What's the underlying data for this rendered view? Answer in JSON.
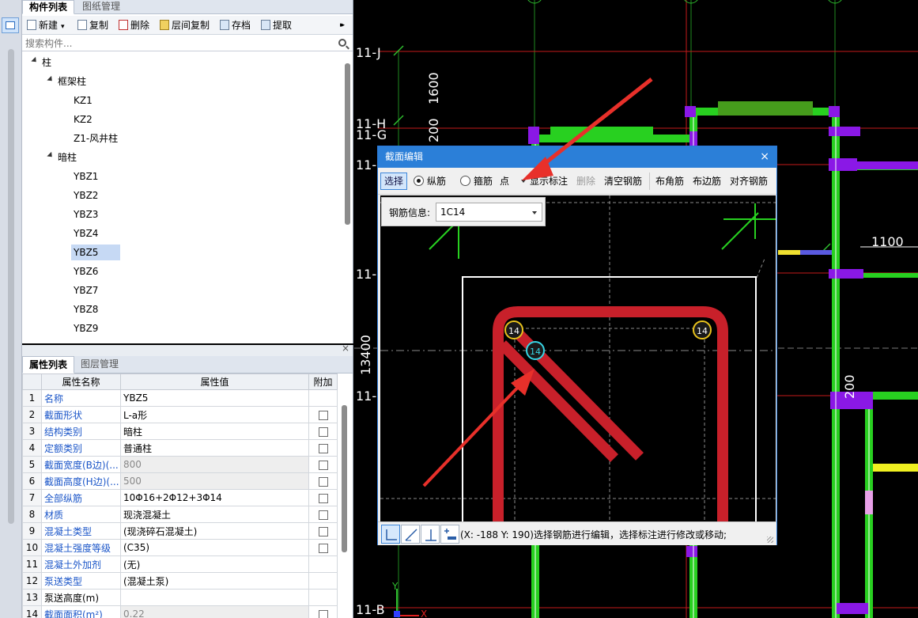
{
  "comp_panel": {
    "tabs": [
      "构件列表",
      "图纸管理"
    ],
    "toolbar": {
      "new": "新建",
      "copy": "复制",
      "delete": "删除",
      "floor_copy": "层间复制",
      "save": "存档",
      "extract": "提取",
      "more": "▸▸"
    },
    "search_placeholder": "搜索构件...",
    "tree": {
      "root": "柱",
      "group1": "框架柱",
      "group1_items": [
        "KZ1",
        "KZ2",
        "Z1-风井柱"
      ],
      "group2": "暗柱",
      "group2_items": [
        "YBZ1",
        "YBZ2",
        "YBZ3",
        "YBZ4",
        "YBZ5",
        "YBZ6",
        "YBZ7",
        "YBZ8",
        "YBZ9"
      ],
      "selected": "YBZ5"
    }
  },
  "prop_panel": {
    "close": "×",
    "tabs": [
      "属性列表",
      "图层管理"
    ],
    "headers": [
      "属性名称",
      "属性值",
      "附加"
    ],
    "rows": [
      {
        "idx": "1",
        "name": "名称",
        "value": "YBZ5"
      },
      {
        "idx": "2",
        "name": "截面形状",
        "value": "L-a形"
      },
      {
        "idx": "3",
        "name": "结构类别",
        "value": "暗柱"
      },
      {
        "idx": "4",
        "name": "定额类别",
        "value": "普通柱"
      },
      {
        "idx": "5",
        "name": "截面宽度(B边)(...",
        "value": "800"
      },
      {
        "idx": "6",
        "name": "截面高度(H边)(...",
        "value": "500"
      },
      {
        "idx": "7",
        "name": "全部纵筋",
        "value": "10Φ16+2Φ12+3Φ14"
      },
      {
        "idx": "8",
        "name": "材质",
        "value": "现浇混凝土"
      },
      {
        "idx": "9",
        "name": "混凝土类型",
        "value": "(现浇碎石混凝土)"
      },
      {
        "idx": "10",
        "name": "混凝土强度等级",
        "value": "(C35)"
      },
      {
        "idx": "11",
        "name": "混凝土外加剂",
        "value": "(无)"
      },
      {
        "idx": "12",
        "name": "泵送类型",
        "value": "(混凝土泵)"
      },
      {
        "idx": "13",
        "name": "泵送高度(m)",
        "value": ""
      },
      {
        "idx": "14",
        "name": "截面面积(m²)",
        "value": "0.22"
      }
    ]
  },
  "cad": {
    "axis_labels": [
      "11-J",
      "11-H",
      "11-G",
      "11-",
      "11-",
      "11-",
      "11-B"
    ],
    "dims": {
      "d1600": "1600",
      "d200a": "200",
      "d1100": "1100",
      "d13400": "13400",
      "d200b": "200"
    },
    "ucs_y": "Y",
    "ucs_x": "X"
  },
  "dialog": {
    "title": "截面编辑",
    "close": "×",
    "toolbar": {
      "select": "选择",
      "longitudinal": "纵筋",
      "stirrup": "箍筋",
      "point": "点",
      "show_label": "显示标注",
      "delete": "删除",
      "clear_rebar": "清空钢筋",
      "corner_rebar": "布角筋",
      "edge_rebar": "布边筋",
      "align_rebar": "对齐钢筋"
    },
    "rebar_info": {
      "label": "钢筋信息:",
      "value": "1C14"
    },
    "rebar_labels": [
      "14",
      "14",
      "14"
    ],
    "status": "(X: -188 Y: 190)选择钢筋进行编辑，选择标注进行修改或移动;"
  },
  "colors": {
    "accent": "#2b7fd8",
    "rebar_red": "#c8202a",
    "rebar_yellow": "#e8c21c",
    "rebar_cyan": "#37d6e6",
    "cad_green": "#28d020",
    "cad_purple": "#8a18e6",
    "cad_red": "#d01818"
  }
}
